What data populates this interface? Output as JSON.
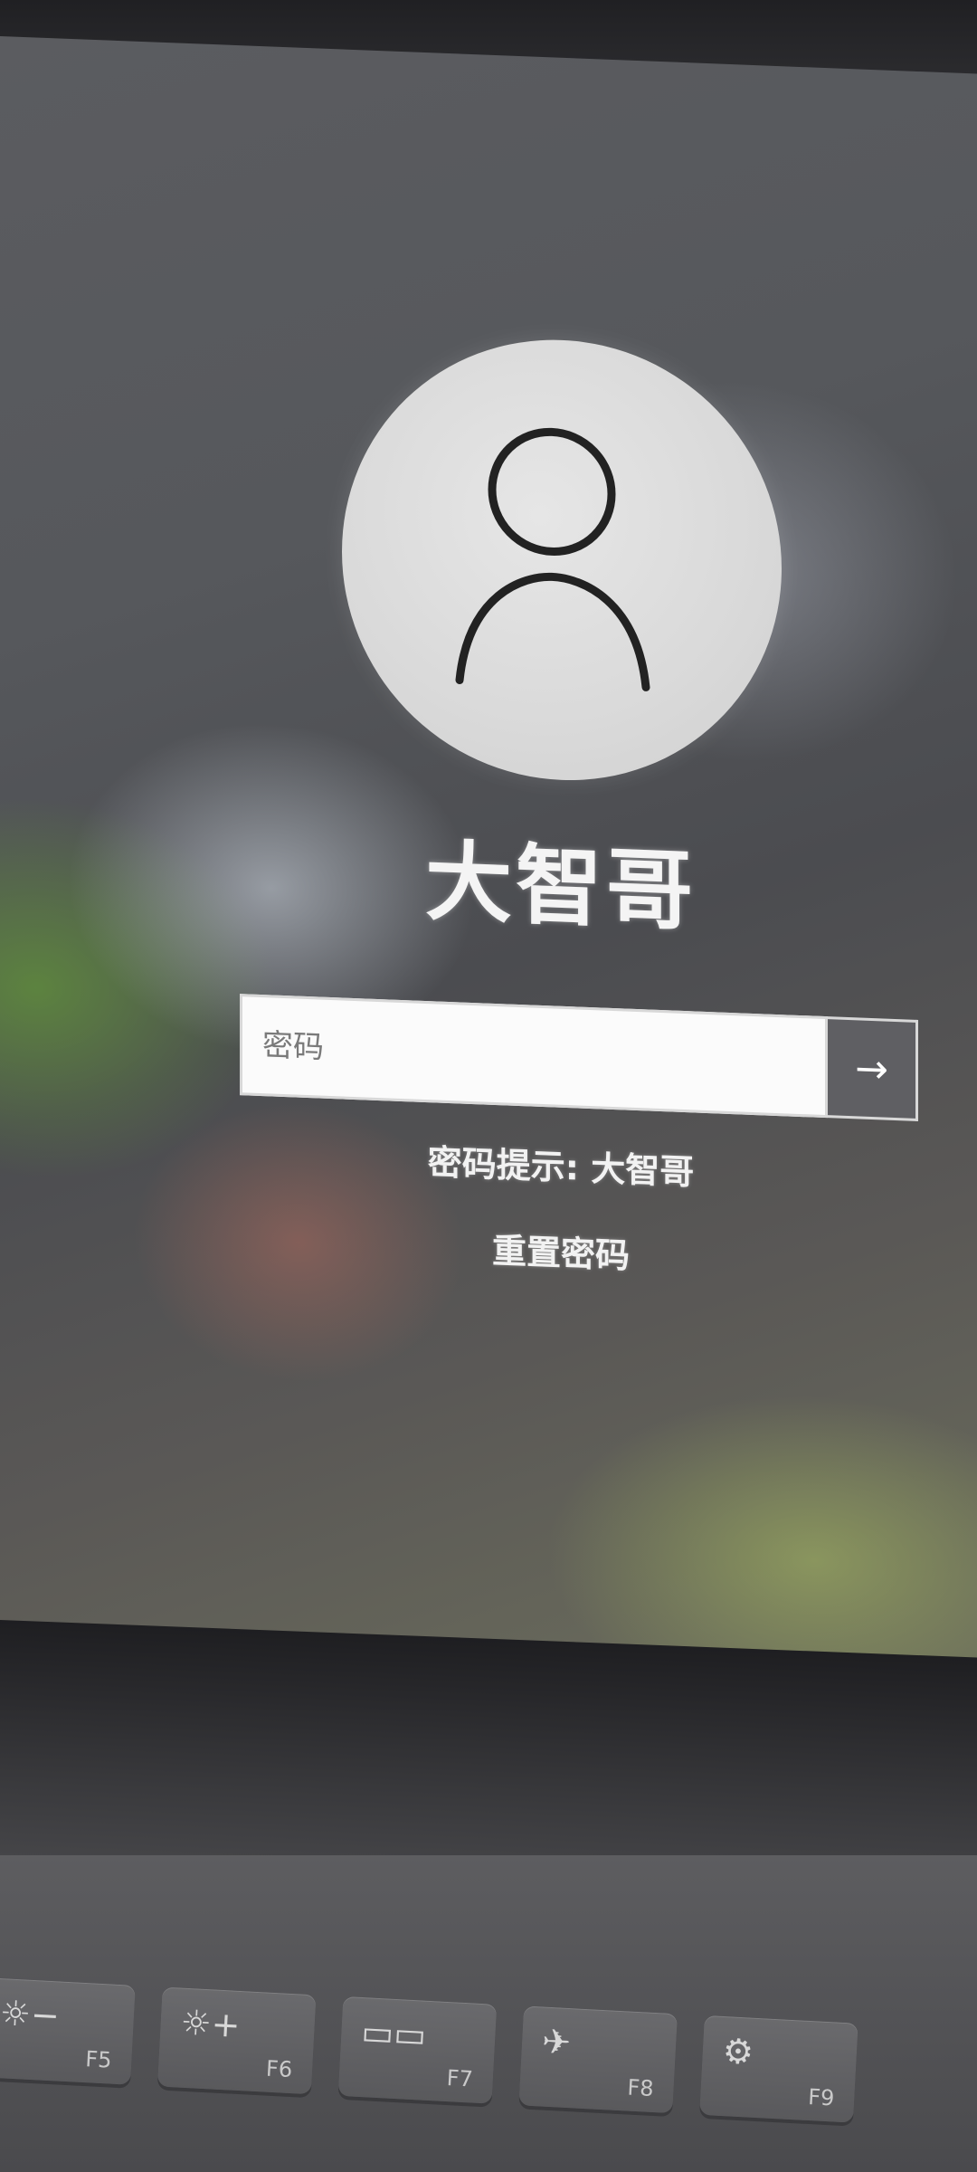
{
  "user": {
    "name": "大智哥"
  },
  "password": {
    "placeholder": "密码",
    "value": ""
  },
  "submit": {
    "icon": "arrow-right-icon",
    "glyph": "→"
  },
  "hint": {
    "text": "密码提示: 大智哥"
  },
  "reset": {
    "label": "重置密码"
  },
  "keyboard": {
    "keys": [
      {
        "glyph": "☼−",
        "fn": "F5",
        "icon": "brightness-down-icon"
      },
      {
        "glyph": "☼+",
        "fn": "F6",
        "icon": "brightness-up-icon"
      },
      {
        "glyph": "▭▭",
        "fn": "F7",
        "icon": "display-switch-icon"
      },
      {
        "glyph": "✈",
        "fn": "F8",
        "icon": "airplane-mode-icon"
      },
      {
        "glyph": "⚙",
        "fn": "F9",
        "icon": "settings-icon"
      }
    ]
  }
}
